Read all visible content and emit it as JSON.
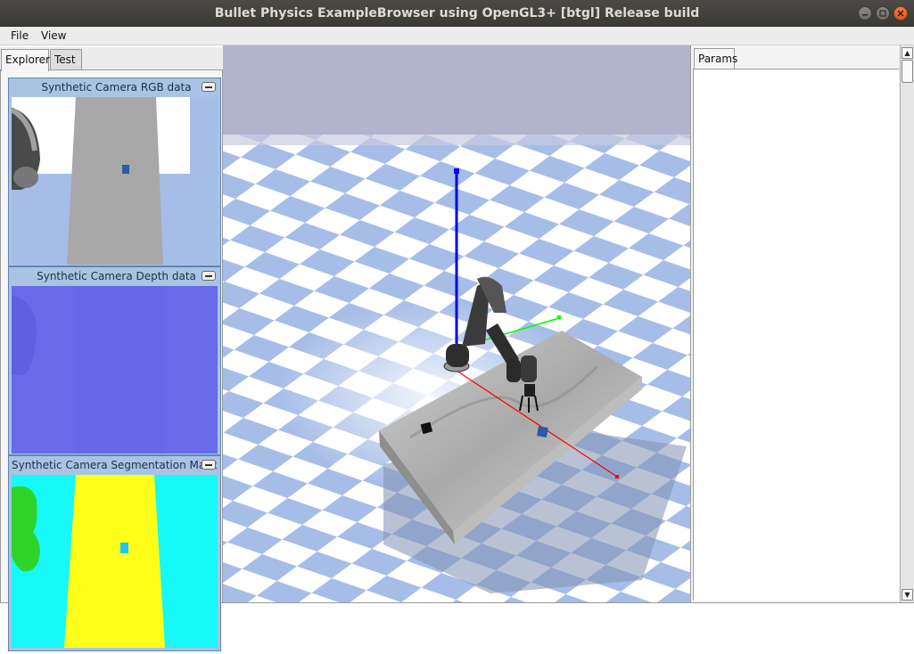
{
  "window": {
    "title": "Bullet Physics ExampleBrowser using OpenGL3+ [btgl] Release build",
    "controls": [
      "minimize-icon",
      "maximize-icon",
      "close-icon"
    ]
  },
  "menu": {
    "file": "File",
    "view": "View"
  },
  "left_tabs": {
    "explorer": "Explorer",
    "test": "Test"
  },
  "right_tabs": {
    "params": "Params"
  },
  "cameras": {
    "rgb": {
      "title": "Synthetic Camera RGB data"
    },
    "depth": {
      "title": "Synthetic Camera Depth data"
    },
    "seg": {
      "title": "Synthetic Camera Segmentation Mask"
    }
  },
  "colors": {
    "floor_light": "#ffffff",
    "floor_blue": "#a6bde8",
    "sky": "#b2b3cd",
    "axis_z": "#0000ff",
    "axis_x": "#ff0000",
    "axis_y": "#00ff00",
    "depth_bg": "#6a69ea",
    "seg_cyan": "#17f8f9",
    "seg_yellow": "#ffff1a",
    "seg_green": "#2fd42b"
  }
}
